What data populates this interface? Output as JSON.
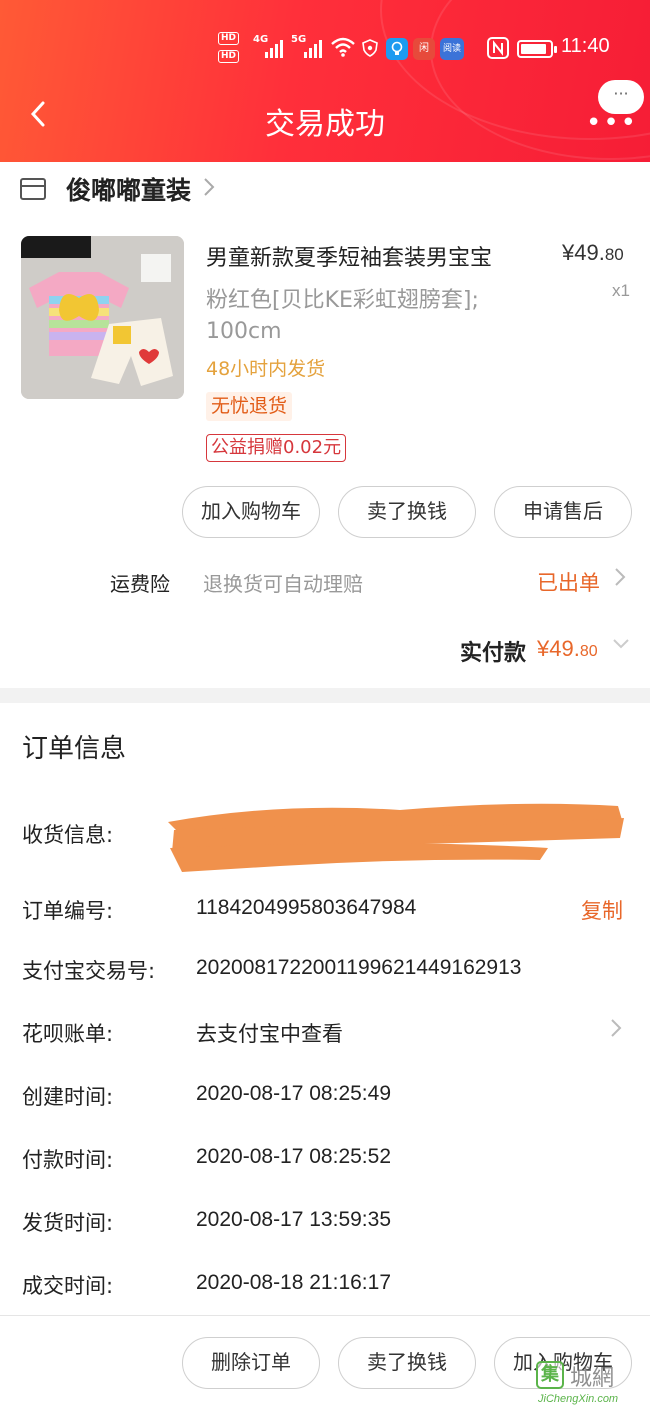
{
  "status_bar": {
    "hd1": "HD",
    "hd2": "HD",
    "net1": "4G",
    "net2": "5G",
    "app1": "闲",
    "app2": "阅读",
    "time": "11:40",
    "battery_level": 0.9
  },
  "header": {
    "title": "交易成功",
    "bubble": "···",
    "more": "•••",
    "back_icon": "chevron-left-icon",
    "accent_color": "#ff2f3a"
  },
  "shop": {
    "name": "俊嘟嘟童装"
  },
  "product": {
    "title": "男童新款夏季短袖套装男宝宝",
    "price_main": "¥49.",
    "price_cents": "80",
    "quantity": "x1",
    "sku_line1": "粉红色[贝比KE彩虹翅膀套];",
    "sku_line2": "100cm",
    "shipping_note": "48小时内发货",
    "tag_return": "无忧退货",
    "tag_charity": "公益捐赠0.02元"
  },
  "actions": {
    "add_cart": "加入购物车",
    "resell": "卖了换钱",
    "after_sale": "申请售后"
  },
  "insurance": {
    "label": "运费险",
    "desc": "退换货可自动理赔",
    "status": "已出单"
  },
  "payment": {
    "label": "实付款",
    "price_main": "¥49.",
    "price_cents": "80"
  },
  "order_info": {
    "title": "订单信息",
    "receiver_label": "收货信息:",
    "order_no_label": "订单编号:",
    "order_no": "1184204995803647984",
    "copy": "复制",
    "alipay_label": "支付宝交易号:",
    "alipay_no": "2020081722001199621449162913",
    "huabei_label": "花呗账单:",
    "huabei_value": "去支付宝中查看",
    "created_label": "创建时间:",
    "created": "2020-08-17 08:25:49",
    "paid_label": "付款时间:",
    "paid": "2020-08-17 08:25:52",
    "shipped_label": "发货时间:",
    "shipped": "2020-08-17 13:59:35",
    "done_label": "成交时间:",
    "done": "2020-08-18 21:16:17"
  },
  "bottom_bar": {
    "delete": "删除订单",
    "resell": "卖了换钱",
    "add_cart": "加入购物车"
  },
  "watermark": {
    "logo_char": "集",
    "text": "城網",
    "url": "JiChengXin.com"
  }
}
